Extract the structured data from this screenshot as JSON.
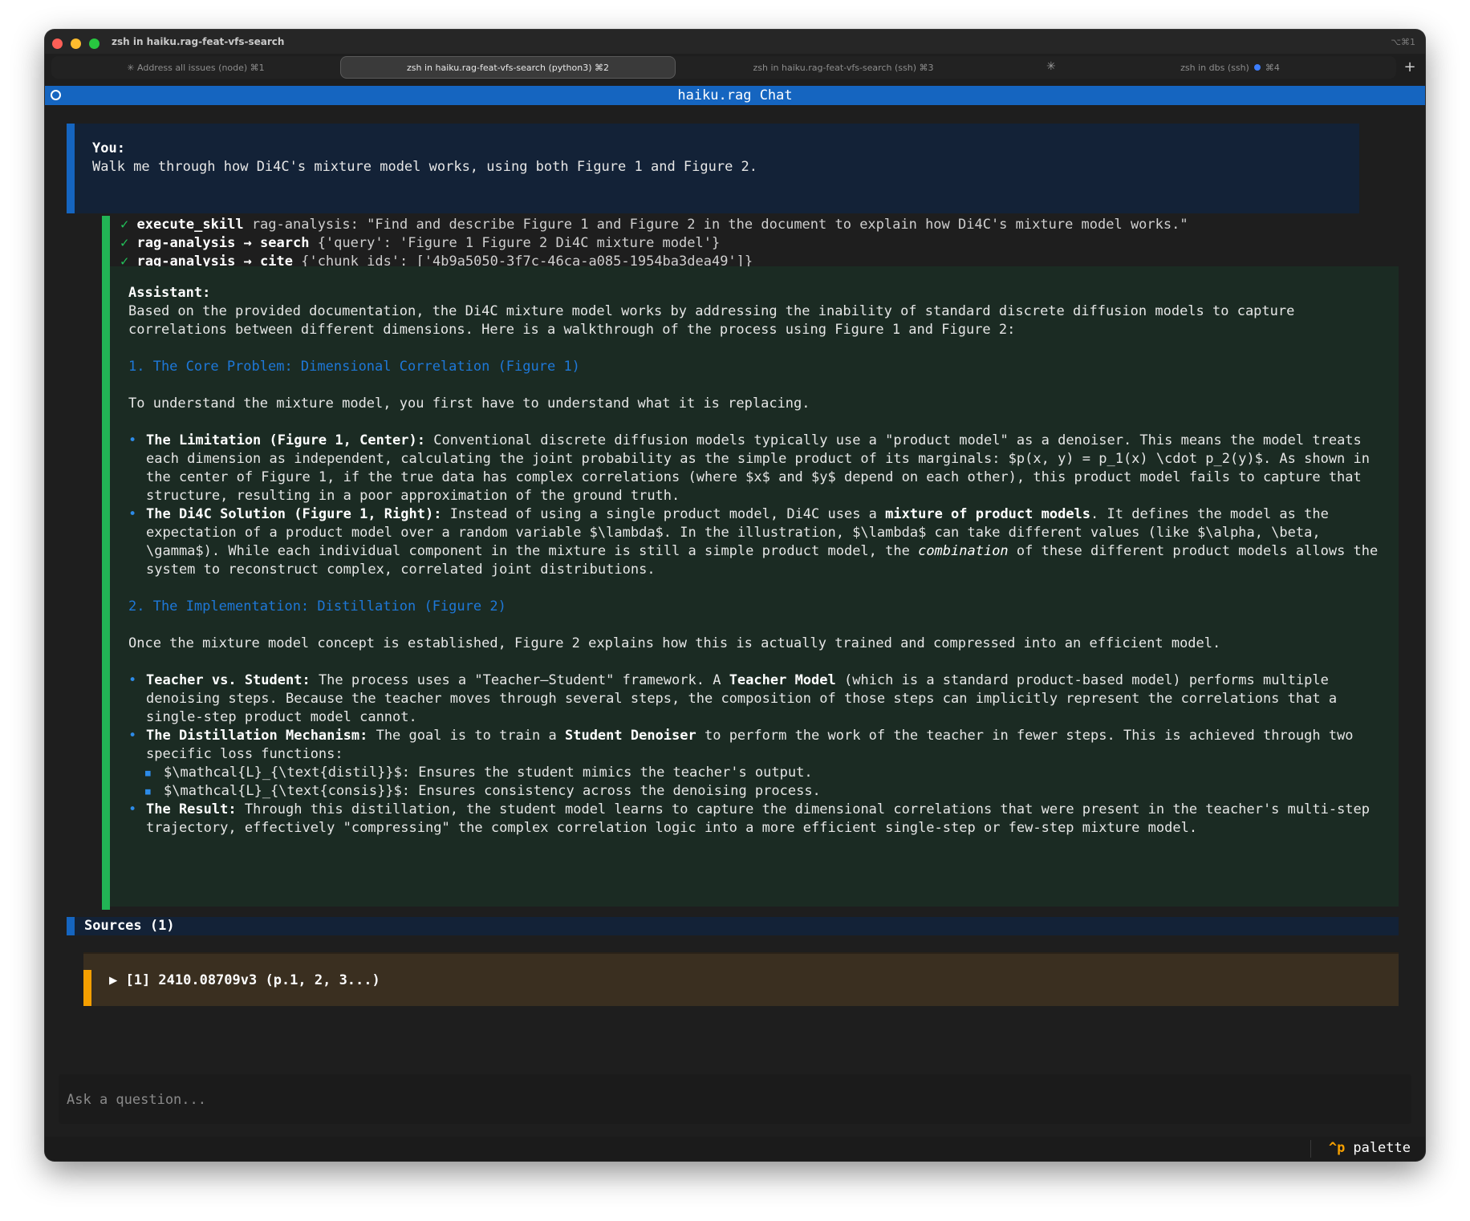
{
  "window": {
    "title": "zsh in haiku.rag-feat-vfs-search",
    "shortcut_hint": "⌥⌘1"
  },
  "tabs": [
    {
      "label": "✳ Address all issues (node) ⌘1",
      "active": false
    },
    {
      "label": "zsh in haiku.rag-feat-vfs-search (python3) ⌘2",
      "active": true
    },
    {
      "label": "zsh in haiku.rag-feat-vfs-search (ssh) ⌘3",
      "active": false
    },
    {
      "label_pre": "zsh in dbs (ssh)",
      "label_post": "⌘4",
      "active": false
    }
  ],
  "new_tab_label": "+",
  "app": {
    "title": "haiku.rag Chat"
  },
  "user_message": {
    "label": "You:",
    "text": "Walk me through how Di4C's mixture model works, using both Figure 1 and Figure 2."
  },
  "tool_calls": [
    {
      "check": "✓",
      "name": "execute_skill",
      "args": "rag-analysis: \"Find and describe Figure 1 and Figure 2 in the document to explain how Di4C's mixture model works.\""
    },
    {
      "check": "✓",
      "name": "rag-analysis → search",
      "args": "{'query': 'Figure 1 Figure 2 Di4C mixture model'}"
    },
    {
      "check": "✓",
      "name": "rag-analysis → cite",
      "args": "{'chunk_ids': ['4b9a5050-3f7c-46ca-a085-1954ba3dea49']}"
    }
  ],
  "assistant": {
    "label": "Assistant:",
    "intro": "Based on the provided documentation, the Di4C mixture model works by addressing the inability of standard discrete diffusion models to capture correlations between different dimensions. Here is a walkthrough of the process using Figure 1 and Figure 2:",
    "section1": {
      "heading": "1. The Core Problem: Dimensional Correlation (Figure 1)",
      "lead": "To understand the mixture model, you first have to understand what it is replacing.",
      "b1_title": "The Limitation (Figure 1, Center):",
      "b1_text": " Conventional discrete diffusion models typically use a \"product model\" as a denoiser. This means the model treats each dimension as independent, calculating the joint probability as the simple product of its marginals: $p(x, y) = p_1(x) \\cdot p_2(y)$. As shown in the center of Figure 1, if the true data has complex correlations (where $x$ and $y$ depend on each other), this product model fails to capture that structure, resulting in a poor approximation of the ground truth.",
      "b2_title": "The Di4C Solution (Figure 1, Right):",
      "b2_text_a": " Instead of using a single product model, Di4C uses a ",
      "b2_bold": "mixture of product models",
      "b2_text_b": ". It defines the model as the expectation of a product model over a random variable $\\lambda$. In the illustration, $\\lambda$ can take different values (like $\\alpha, \\beta, \\gamma$). While each individual component in the mixture is still a simple product model, the ",
      "b2_italic": "combination",
      "b2_text_c": " of these different product models allows the system to reconstruct complex, correlated joint distributions."
    },
    "section2": {
      "heading": "2. The Implementation: Distillation (Figure 2)",
      "lead": "Once the mixture model concept is established, Figure 2 explains how this is actually trained and compressed into an efficient model.",
      "b1_title": "Teacher vs. Student:",
      "b1_text_a": " The process uses a \"Teacher–Student\" framework. A ",
      "b1_bold": "Teacher Model",
      "b1_text_b": " (which is a standard product-based model) performs multiple denoising steps. Because the teacher moves through several steps, the composition of those steps can implicitly represent the correlations that a single-step product model cannot.",
      "b2_title": "The Distillation Mechanism:",
      "b2_text_a": " The goal is to train a ",
      "b2_bold": "Student Denoiser",
      "b2_text_b": " to perform the work of the teacher in fewer steps. This is achieved through two specific loss functions:",
      "sub1": "$\\mathcal{L}_{\\text{distil}}$: Ensures the student mimics the teacher's output.",
      "sub2": "$\\mathcal{L}_{\\text{consis}}$: Ensures consistency across the denoising process.",
      "b3_title": "The Result:",
      "b3_text": " Through this distillation, the student model learns to capture the dimensional correlations that were present in the teacher's multi-step trajectory, effectively \"compressing\" the complex correlation logic into a more efficient single-step or few-step mixture model."
    }
  },
  "sources": {
    "header": "Sources (1)",
    "items": [
      {
        "label": "▶ [1] 2410.08709v3 (p.1, 2, 3...)"
      }
    ]
  },
  "input": {
    "placeholder": "Ask a question..."
  },
  "footer": {
    "key": "^p",
    "label": "palette"
  },
  "colors": {
    "header_blue": "#1565c0",
    "tool_green": "#22b455",
    "heading_blue": "#1e78d8",
    "source_orange": "#f59f00"
  }
}
